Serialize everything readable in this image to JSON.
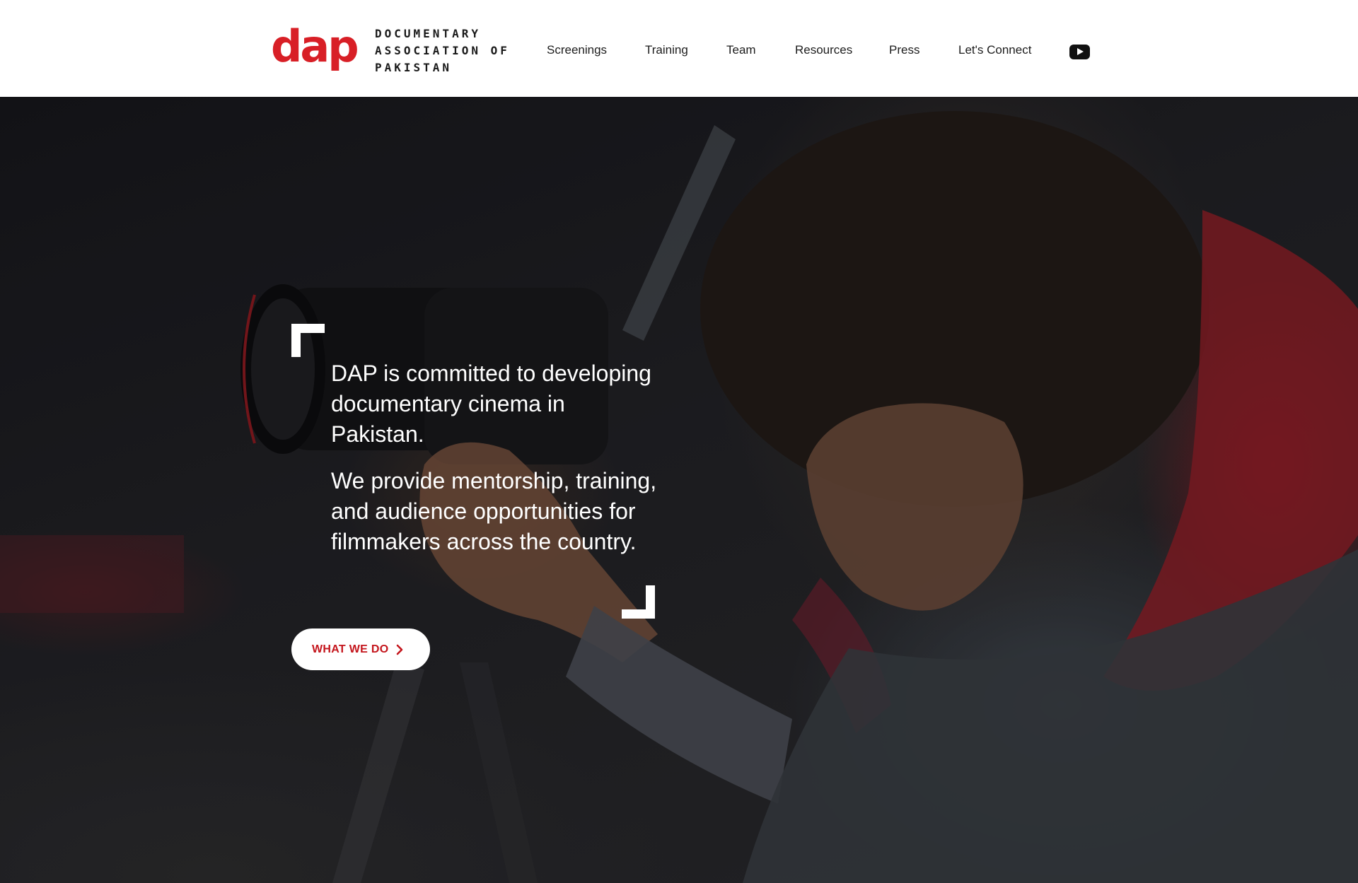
{
  "brand": {
    "logo_text": "dap",
    "name_lines": [
      "DOCUMENTARY",
      "ASSOCIATION OF",
      "PAKISTAN"
    ],
    "color": "#d81f26"
  },
  "nav": {
    "items": [
      {
        "label": "Screenings"
      },
      {
        "label": "Training"
      },
      {
        "label": "Team"
      },
      {
        "label": "Resources"
      },
      {
        "label": "Press"
      },
      {
        "label": "Let's Connect"
      }
    ],
    "social_icon": "youtube-icon"
  },
  "hero": {
    "paragraphs": [
      "DAP is committed to developing documentary cinema in Pakistan.",
      "We provide mentorship, training, and audience opportunities for filmmakers across the country."
    ],
    "cta_label": "WHAT WE DO",
    "cta_icon": "chevron-right-icon",
    "cta_color": "#c4151c",
    "image_description_icon": "filmmaker-photo"
  }
}
